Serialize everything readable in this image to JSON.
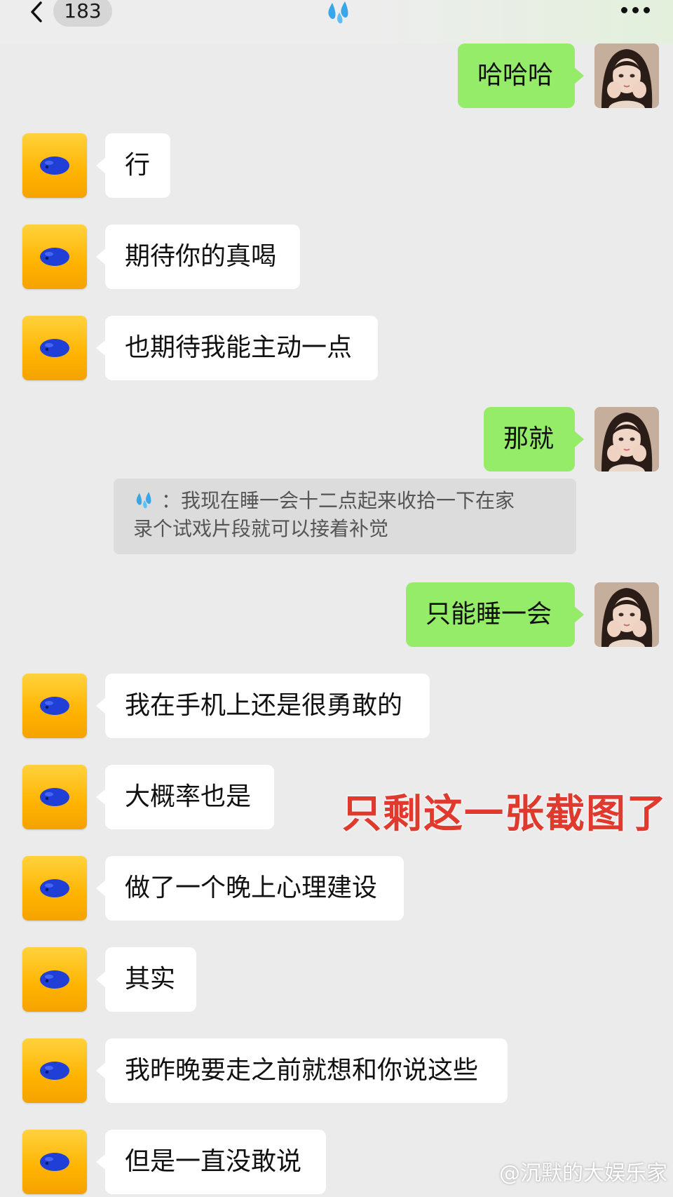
{
  "header": {
    "unread_count": "183",
    "title_icon": "sweat-droplets-emoji",
    "back_icon": "chevron-left-icon",
    "more_icon": "more-dots-icon"
  },
  "messages": [
    {
      "side": "out",
      "text": "哈哈哈"
    },
    {
      "side": "in",
      "text": "行"
    },
    {
      "side": "in",
      "text": "期待你的真喝"
    },
    {
      "side": "in",
      "text": "也期待我能主动一点"
    },
    {
      "side": "out",
      "text": "那就"
    },
    {
      "side": "out",
      "text": "只能睡一会"
    },
    {
      "side": "in",
      "text": "我在手机上还是很勇敢的"
    },
    {
      "side": "in",
      "text": "大概率也是"
    },
    {
      "side": "in",
      "text": "做了一个晚上心理建设"
    },
    {
      "side": "in",
      "text": "其实"
    },
    {
      "side": "in",
      "text": "我昨晚要走之前就想和你说这些"
    },
    {
      "side": "in",
      "text": "但是一直没敢说"
    }
  ],
  "quote": {
    "sender_icon": "sweat-droplets-emoji",
    "separator": "：",
    "line1": "我现在睡一会十二点起来收拾一下在家",
    "line2": "录个试戏片段就可以接着补觉"
  },
  "overlay_text": "只剩这一张截图了",
  "watermark": "@沉默的大娱乐家",
  "colors": {
    "background": "#ebebeb",
    "bubble_out": "#95ec69",
    "bubble_in": "#ffffff",
    "overlay_red": "#e03a2f",
    "avatar_yellow": "#ffb300",
    "avatar_blue": "#1f3fd6"
  }
}
